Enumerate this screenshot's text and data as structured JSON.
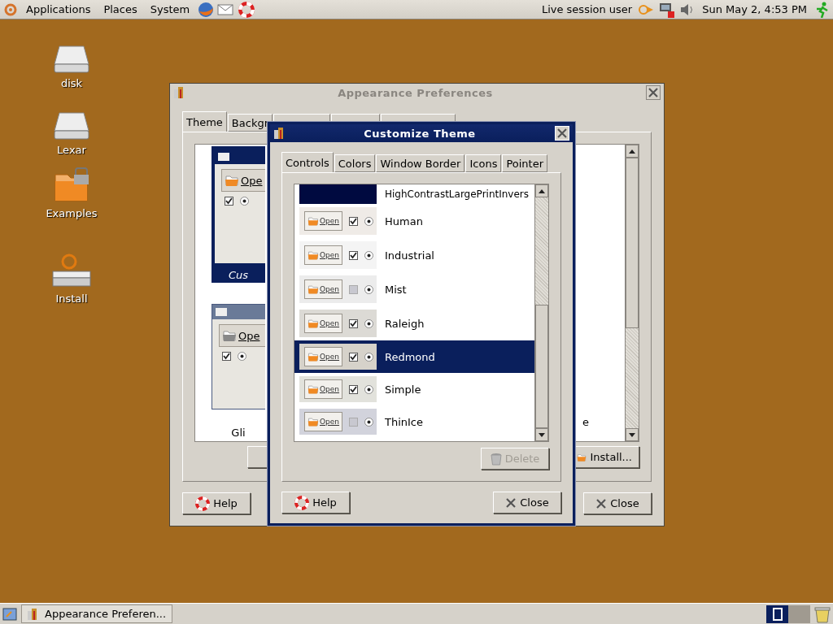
{
  "top_panel": {
    "menus": [
      {
        "label": "Applications"
      },
      {
        "label": "Places"
      },
      {
        "label": "System"
      }
    ],
    "user": "Live session user",
    "clock": "Sun May  2,  4:53 PM"
  },
  "desktop_icons": [
    {
      "label": "disk",
      "kind": "drive"
    },
    {
      "label": "Lexar",
      "kind": "drive"
    },
    {
      "label": "Examples",
      "kind": "folder"
    },
    {
      "label": "Install",
      "kind": "installer"
    }
  ],
  "appearance_window": {
    "title": "Appearance Preferences",
    "tabs": [
      {
        "label": "Theme",
        "selected": true
      },
      {
        "label": "Backgr",
        "selected": false
      }
    ],
    "theme_previews": [
      {
        "button": "Ope",
        "label": "Cus",
        "selected": true
      },
      {
        "button": "Ope",
        "label": "Gli",
        "selected": false
      }
    ],
    "right_fragment": "e",
    "install_button": "Install...",
    "help_button": "Help",
    "close_button": "Close"
  },
  "customize_window": {
    "title": "Customize Theme",
    "tabs": [
      {
        "label": "Controls",
        "selected": true
      },
      {
        "label": "Colors",
        "selected": false
      },
      {
        "label": "Window Border",
        "selected": false
      },
      {
        "label": "Icons",
        "selected": false
      },
      {
        "label": "Pointer",
        "selected": false
      }
    ],
    "themes": [
      {
        "name": "HighContrastLargePrintInvers",
        "color": "#000a40",
        "selected": false
      },
      {
        "name": "Human",
        "button": "Open",
        "color": "#efebe7",
        "checked": true,
        "selected": false
      },
      {
        "name": "Industrial",
        "button": "Open",
        "color": "#f4f4f4",
        "checked": true,
        "selected": false
      },
      {
        "name": "Mist",
        "button": "Open",
        "color": "#ececec",
        "checked": false,
        "selected": false
      },
      {
        "name": "Raleigh",
        "button": "Open",
        "color": "#dcdad5",
        "checked": true,
        "selected": false
      },
      {
        "name": "Redmond",
        "button": "Open",
        "color": "#d6d2ca",
        "checked": true,
        "selected": true
      },
      {
        "name": "Simple",
        "button": "Open",
        "color": "#e2e2dc",
        "checked": true,
        "selected": false
      },
      {
        "name": "ThinIce",
        "button": "Open",
        "color": "#d2d3dc",
        "checked": false,
        "selected": false
      }
    ],
    "delete_button": {
      "label": "Delete",
      "disabled": true
    },
    "help_button": "Help",
    "close_button": "Close"
  },
  "taskbar": {
    "tasks": [
      {
        "label": "Appearance Preferen...",
        "selected": false
      }
    ]
  }
}
